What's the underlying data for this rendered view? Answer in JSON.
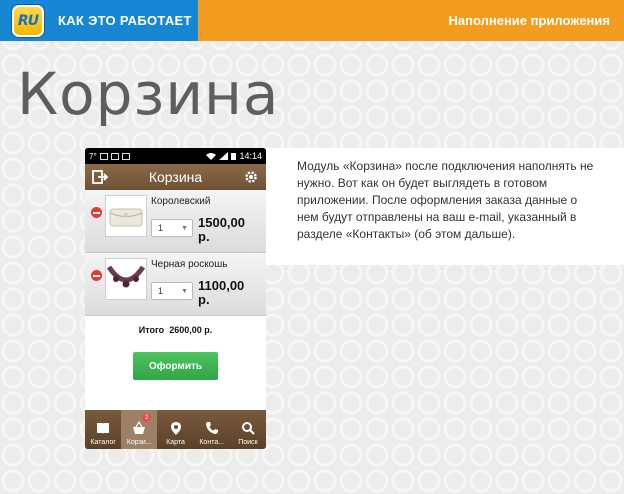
{
  "header": {
    "logo_text": "RU",
    "how_it_works": "КАК ЭТО РАБОТАЕТ",
    "section": "Наполнение приложения"
  },
  "page": {
    "title": "Корзина",
    "description": "Модуль «Корзина» после подключения наполнять не нужно. Вот как он будет выглядеть в готовом приложении. После оформления заказа данные о нем будут отправлены на ваш e-mail, указанный в разделе «Контакты» (об этом дальше)."
  },
  "phone": {
    "status_time": "14:14",
    "status_left": "7°",
    "appbar_title": "Корзина",
    "items": [
      {
        "name": "Королевский",
        "qty": "1",
        "price": "1500,00 р."
      },
      {
        "name": "Черная роскошь",
        "qty": "1",
        "price": "1100,00 р."
      }
    ],
    "total_label": "Итого",
    "total_value": "2600,00 р.",
    "order_button": "Оформить",
    "nav": [
      {
        "label": "Каталог",
        "icon": "book-icon"
      },
      {
        "label": "Корзи...",
        "icon": "basket-icon",
        "badge": "2"
      },
      {
        "label": "Карта",
        "icon": "map-pin-icon"
      },
      {
        "label": "Конта...",
        "icon": "phone-icon"
      },
      {
        "label": "Поиск",
        "icon": "search-icon"
      }
    ]
  },
  "colors": {
    "topbar_blue": "#1787d4",
    "topbar_orange": "#f39c1f",
    "app_brown": "#6d5034",
    "order_green": "#31a447",
    "remove_red": "#e53935"
  }
}
